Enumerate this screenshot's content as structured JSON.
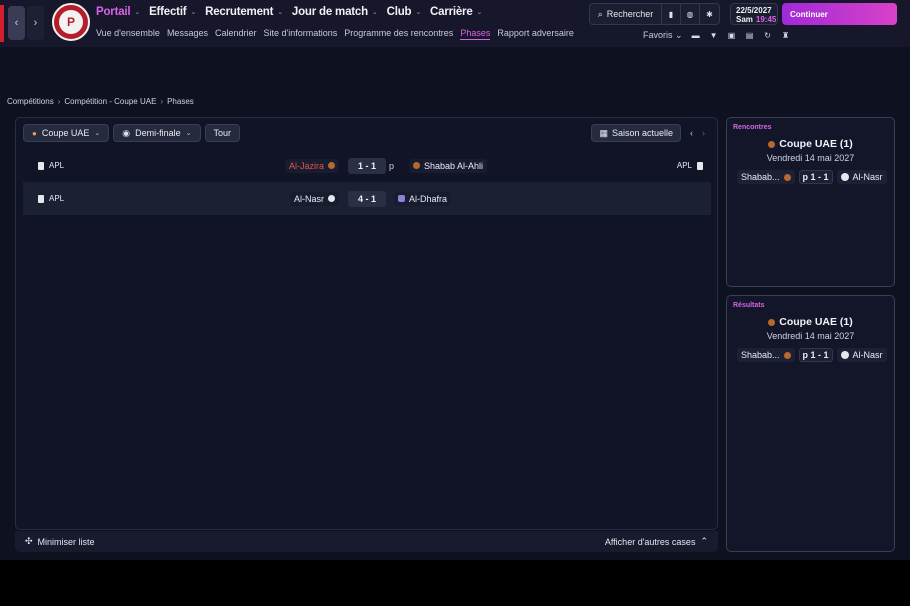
{
  "header": {
    "main_menu": [
      {
        "label": "Portail",
        "active": true
      },
      {
        "label": "Effectif",
        "active": false
      },
      {
        "label": "Recrutement",
        "active": false
      },
      {
        "label": "Jour de match",
        "active": false
      },
      {
        "label": "Club",
        "active": false
      },
      {
        "label": "Carrière",
        "active": false
      }
    ],
    "sub_menu": [
      {
        "label": "Vue d'ensemble",
        "active": false
      },
      {
        "label": "Messages",
        "active": false
      },
      {
        "label": "Calendrier",
        "active": false
      },
      {
        "label": "Site d'informations",
        "active": false
      },
      {
        "label": "Programme des rencontres",
        "active": false
      },
      {
        "label": "Phases",
        "active": true
      },
      {
        "label": "Rapport adversaire",
        "active": false
      }
    ],
    "search_label": "Rechercher",
    "date": "22/5/2027",
    "day": "Sam",
    "time": "19:45",
    "continue_label": "Continuer",
    "favorites_label": "Favoris",
    "accent_color": "#d864e6"
  },
  "breadcrumb": [
    "Compétitions",
    "Compétition - Coupe UAE",
    "Phases"
  ],
  "filters": {
    "competition": "Coupe UAE",
    "stage": "Demi-finale",
    "round": "Tour",
    "season": "Saison actuelle"
  },
  "matches": [
    {
      "comp": "APL",
      "home": "Al-Jazira",
      "score": "1 - 1",
      "suffix": "p",
      "away": "Shabab Al-Ahli",
      "comp_right": "APL"
    },
    {
      "comp": "APL",
      "home": "Al-Nasr",
      "score": "4 - 1",
      "suffix": "",
      "away": "Al-Dhafra",
      "comp_right": ""
    }
  ],
  "footer": {
    "minimize": "Minimiser liste",
    "more": "Afficher d'autres cases"
  },
  "fixtures_card": {
    "title": "Rencontres",
    "comp": "Coupe UAE (1)",
    "date": "Vendredi 14 mai 2027",
    "home": "Shabab...",
    "score": "p 1 - 1",
    "away": "Al-Nasr"
  },
  "results_card": {
    "title": "Résultats",
    "comp": "Coupe UAE (1)",
    "date": "Vendredi 14 mai 2027",
    "home": "Shabab...",
    "score": "p 1 - 1",
    "away": "Al-Nasr"
  }
}
